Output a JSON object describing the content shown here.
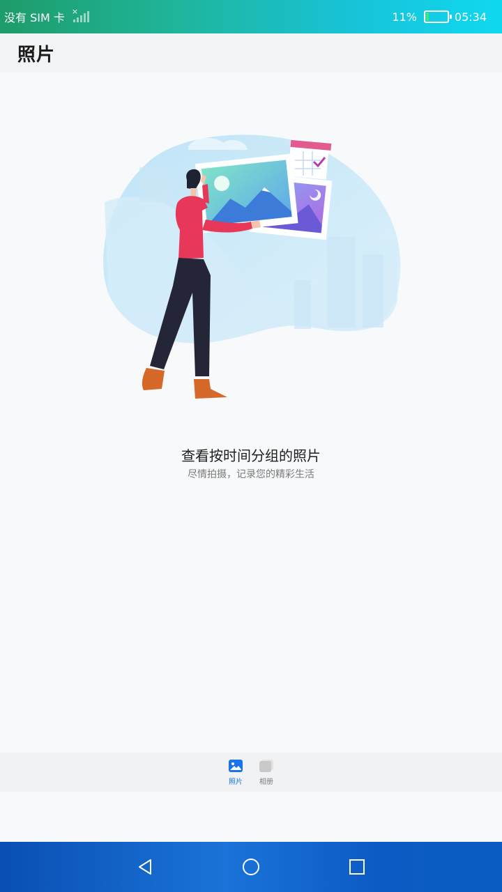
{
  "status_bar": {
    "carrier": "没有 SIM 卡",
    "battery_percent_text": "11%",
    "battery_level": 0.11,
    "time": "05:34"
  },
  "header": {
    "title": "照片"
  },
  "empty_state": {
    "title": "查看按时间分组的照片",
    "subtitle": "尽情拍摄，记录您的精彩生活",
    "illustration_icon": "person-holding-photos-illustration"
  },
  "tabs": [
    {
      "label": "照片",
      "icon": "photo-icon",
      "active": true
    },
    {
      "label": "相册",
      "icon": "album-icon",
      "active": false
    }
  ],
  "nav": {
    "back": "back-triangle-icon",
    "home": "home-circle-icon",
    "recents": "recents-square-icon"
  },
  "colors": {
    "accent": "#1a73e8",
    "shirt": "#e8385a",
    "status_bar_gradient": [
      "#1e9c6a",
      "#0fd8f0"
    ]
  }
}
